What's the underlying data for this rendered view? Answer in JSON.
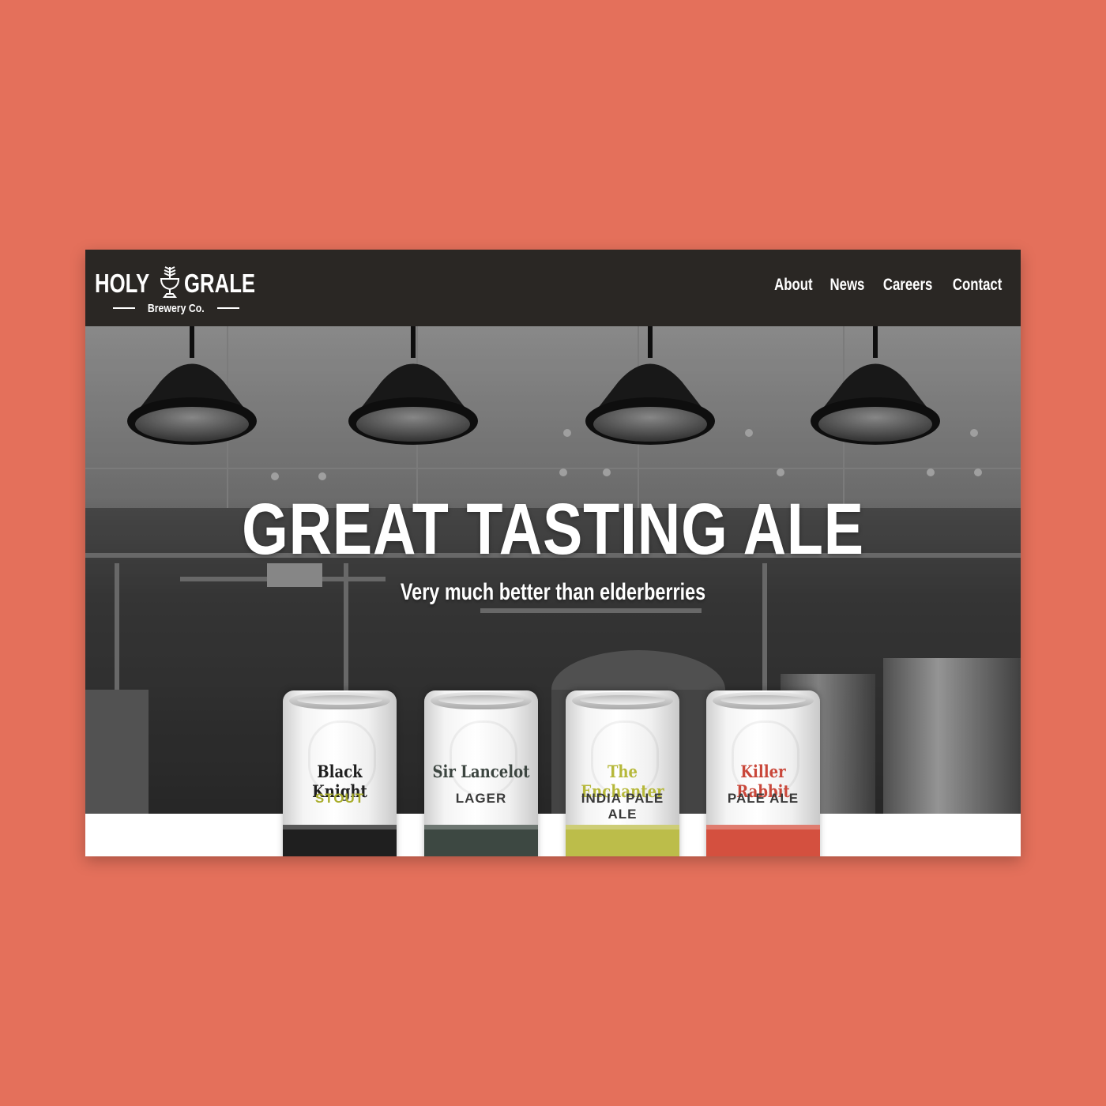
{
  "brand": {
    "word_left": "HOLY",
    "word_right": "GRALE",
    "subtitle": "Brewery Co."
  },
  "nav": {
    "items": [
      "About",
      "News",
      "Careers",
      "Contact"
    ]
  },
  "hero": {
    "title": "GREAT TASTING ALE",
    "subtitle": "Very much better than elderberries"
  },
  "products": [
    {
      "name": "Black Knight",
      "type": "STOUT",
      "name_color": "#1e1e1e",
      "type_color": "#a9ad2c",
      "band_color": "#1f1f1f"
    },
    {
      "name": "Sir Lancelot",
      "type": "LAGER",
      "name_color": "#3c4540",
      "type_color": "#3a3a3a",
      "band_color": "#3d4842"
    },
    {
      "name": "The Enchanter",
      "type": "INDIA PALE ALE",
      "name_color": "#b6b83a",
      "type_color": "#3a3a3a",
      "band_color": "#bcbd4a"
    },
    {
      "name": "Killer Rabbit",
      "type": "PALE ALE",
      "name_color": "#c9473a",
      "type_color": "#3a3a3a",
      "band_color": "#d4503f"
    }
  ],
  "colors": {
    "page_background": "#e4705b",
    "header_background": "#2a2724",
    "text_on_dark": "#ffffff"
  }
}
